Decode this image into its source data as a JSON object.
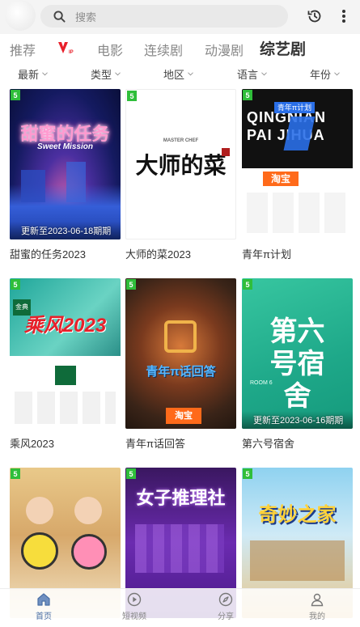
{
  "search": {
    "placeholder": "搜索"
  },
  "tabs": [
    {
      "label": "推荐"
    },
    {
      "label": "VIP"
    },
    {
      "label": "电影"
    },
    {
      "label": "连续剧"
    },
    {
      "label": "动漫剧"
    },
    {
      "label": "综艺剧",
      "active": true
    }
  ],
  "filters": [
    {
      "label": "最新"
    },
    {
      "label": "类型"
    },
    {
      "label": "地区"
    },
    {
      "label": "语言"
    },
    {
      "label": "年份"
    }
  ],
  "cards": [
    {
      "title": "甜蜜的任务2023",
      "badge": "5",
      "update": "更新至2023-06-18期期",
      "poster_text": "甜蜜的任务",
      "poster_sub": "Sweet Mission"
    },
    {
      "title": "大师的菜2023",
      "badge": "5",
      "update": "",
      "poster_text": "大师的菜",
      "poster_sub": "MASTER CHEF"
    },
    {
      "title": "青年π计划",
      "badge": "5",
      "update": "",
      "poster_text": "QINGNIAN PAI JIHUA",
      "poster_sub": "青年π计划",
      "sponsor": "淘宝"
    },
    {
      "title": "乘风2023",
      "badge": "5",
      "update": "",
      "poster_text": "乘风2023",
      "poster_sub": "金典"
    },
    {
      "title": "青年π话回答",
      "badge": "5",
      "update": "",
      "poster_text": "青年π话回答",
      "poster_sub": "淘宝"
    },
    {
      "title": "第六号宿舍",
      "badge": "5",
      "update": "更新至2023-06-16期期",
      "poster_text": "第六号宿舍",
      "poster_sub": "ROOM 6"
    },
    {
      "title": "",
      "badge": "5",
      "update": "",
      "poster_text": "",
      "poster_sub": ""
    },
    {
      "title": "",
      "badge": "5",
      "update": "",
      "poster_text": "女子推理社",
      "poster_sub": ""
    },
    {
      "title": "",
      "badge": "5",
      "update": "",
      "poster_text": "奇妙之家",
      "poster_sub": ""
    }
  ],
  "bottom_nav": [
    {
      "label": "首页",
      "icon": "home-icon",
      "active": true
    },
    {
      "label": "短视频",
      "icon": "play-circle-icon"
    },
    {
      "label": "分享",
      "icon": "compass-icon"
    },
    {
      "label": "我的",
      "icon": "user-icon"
    }
  ],
  "colors": {
    "badge": "#2fbe3a",
    "vip_red": "#e8202a",
    "active_nav": "#4a6fa5"
  }
}
